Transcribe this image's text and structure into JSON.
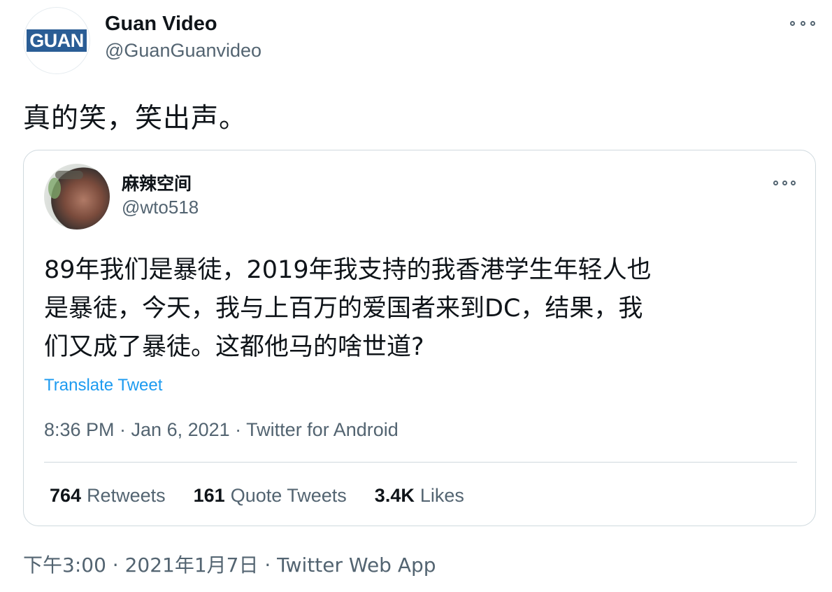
{
  "author": {
    "name": "Guan Video",
    "handle": "@GuanGuanvideo",
    "avatar_text": "GUAN"
  },
  "tweet": {
    "text": "真的笑，笑出声。",
    "footer": "下午3:00 · 2021年1月7日 · Twitter Web App"
  },
  "quoted": {
    "name": "麻辣空间",
    "handle": "@wto518",
    "lines": [
      "89年我们是暴徒，2019年我支持的我香港学生年轻人也",
      "是暴徒，今天，我与上百万的爱国者来到DC，结果，我",
      "们又成了暴徒。这都他马的啥世道?"
    ],
    "translate_label": "Translate Tweet",
    "meta": "8:36 PM · Jan 6, 2021 · Twitter for Android",
    "stats": [
      {
        "count": "764",
        "label": "Retweets"
      },
      {
        "count": "161",
        "label": "Quote Tweets"
      },
      {
        "count": "3.4K",
        "label": "Likes"
      }
    ]
  },
  "colors": {
    "link": "#1d9bf0",
    "secondary_text": "#536471",
    "border": "#cfd9de",
    "logo_bg": "#2a5d95"
  }
}
